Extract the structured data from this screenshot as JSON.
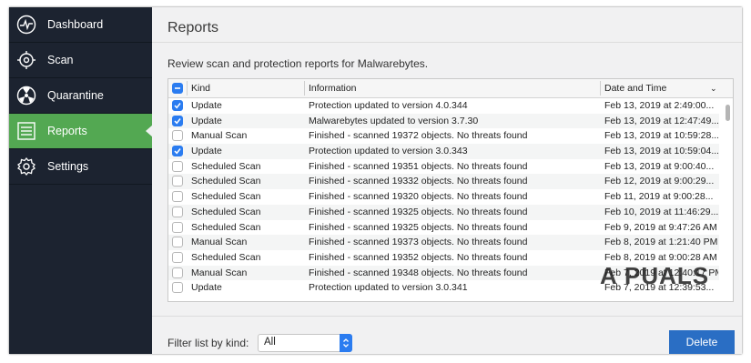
{
  "sidebar": {
    "items": [
      {
        "label": "Dashboard",
        "icon": "dashboard-icon"
      },
      {
        "label": "Scan",
        "icon": "scan-icon"
      },
      {
        "label": "Quarantine",
        "icon": "quarantine-icon"
      },
      {
        "label": "Reports",
        "icon": "reports-icon",
        "active": true
      },
      {
        "label": "Settings",
        "icon": "settings-icon"
      }
    ]
  },
  "main": {
    "title": "Reports",
    "description": "Review scan and protection reports for Malwarebytes.",
    "table": {
      "columns": [
        "Kind",
        "Information",
        "Date and Time"
      ],
      "rows": [
        {
          "checked": true,
          "kind": "Update",
          "info": "Protection updated to version 4.0.344",
          "date": "Feb 13, 2019 at 2:49:00..."
        },
        {
          "checked": true,
          "kind": "Update",
          "info": "Malwarebytes updated to version 3.7.30",
          "date": "Feb 13, 2019 at 12:47:49..."
        },
        {
          "checked": false,
          "kind": "Manual Scan",
          "info": "Finished - scanned 19372 objects. No threats found",
          "date": "Feb 13, 2019 at 10:59:28..."
        },
        {
          "checked": true,
          "kind": "Update",
          "info": "Protection updated to version 3.0.343",
          "date": "Feb 13, 2019 at 10:59:04..."
        },
        {
          "checked": false,
          "kind": "Scheduled Scan",
          "info": "Finished - scanned 19351 objects. No threats found",
          "date": "Feb 13, 2019 at 9:00:40..."
        },
        {
          "checked": false,
          "kind": "Scheduled Scan",
          "info": "Finished - scanned 19332 objects. No threats found",
          "date": "Feb 12, 2019 at 9:00:29..."
        },
        {
          "checked": false,
          "kind": "Scheduled Scan",
          "info": "Finished - scanned 19320 objects. No threats found",
          "date": "Feb 11, 2019 at 9:00:28..."
        },
        {
          "checked": false,
          "kind": "Scheduled Scan",
          "info": "Finished - scanned 19325 objects. No threats found",
          "date": "Feb 10, 2019 at 11:46:29..."
        },
        {
          "checked": false,
          "kind": "Scheduled Scan",
          "info": "Finished - scanned 19325 objects. No threats found",
          "date": "Feb 9, 2019 at 9:47:26 AM"
        },
        {
          "checked": false,
          "kind": "Manual Scan",
          "info": "Finished - scanned 19373 objects. No threats found",
          "date": "Feb 8, 2019 at 1:21:40 PM"
        },
        {
          "checked": false,
          "kind": "Scheduled Scan",
          "info": "Finished - scanned 19352 objects. No threats found",
          "date": "Feb 8, 2019 at 9:00:28 AM"
        },
        {
          "checked": false,
          "kind": "Manual Scan",
          "info": "Finished - scanned 19348 objects. No threats found",
          "date": "Feb 7, 2019 at 12:40:17 PM"
        },
        {
          "checked": false,
          "kind": "Update",
          "info": "Protection updated to version 3.0.341",
          "date": "Feb 7, 2019 at 12:39:53..."
        }
      ]
    },
    "filter": {
      "label": "Filter list by kind:",
      "value": "All"
    },
    "delete_label": "Delete",
    "watermark": "A  PUALS"
  },
  "colors": {
    "sidebar": "#1c2330",
    "active": "#53a852",
    "accent": "#2b7cf0",
    "button": "#2a6ec4"
  }
}
